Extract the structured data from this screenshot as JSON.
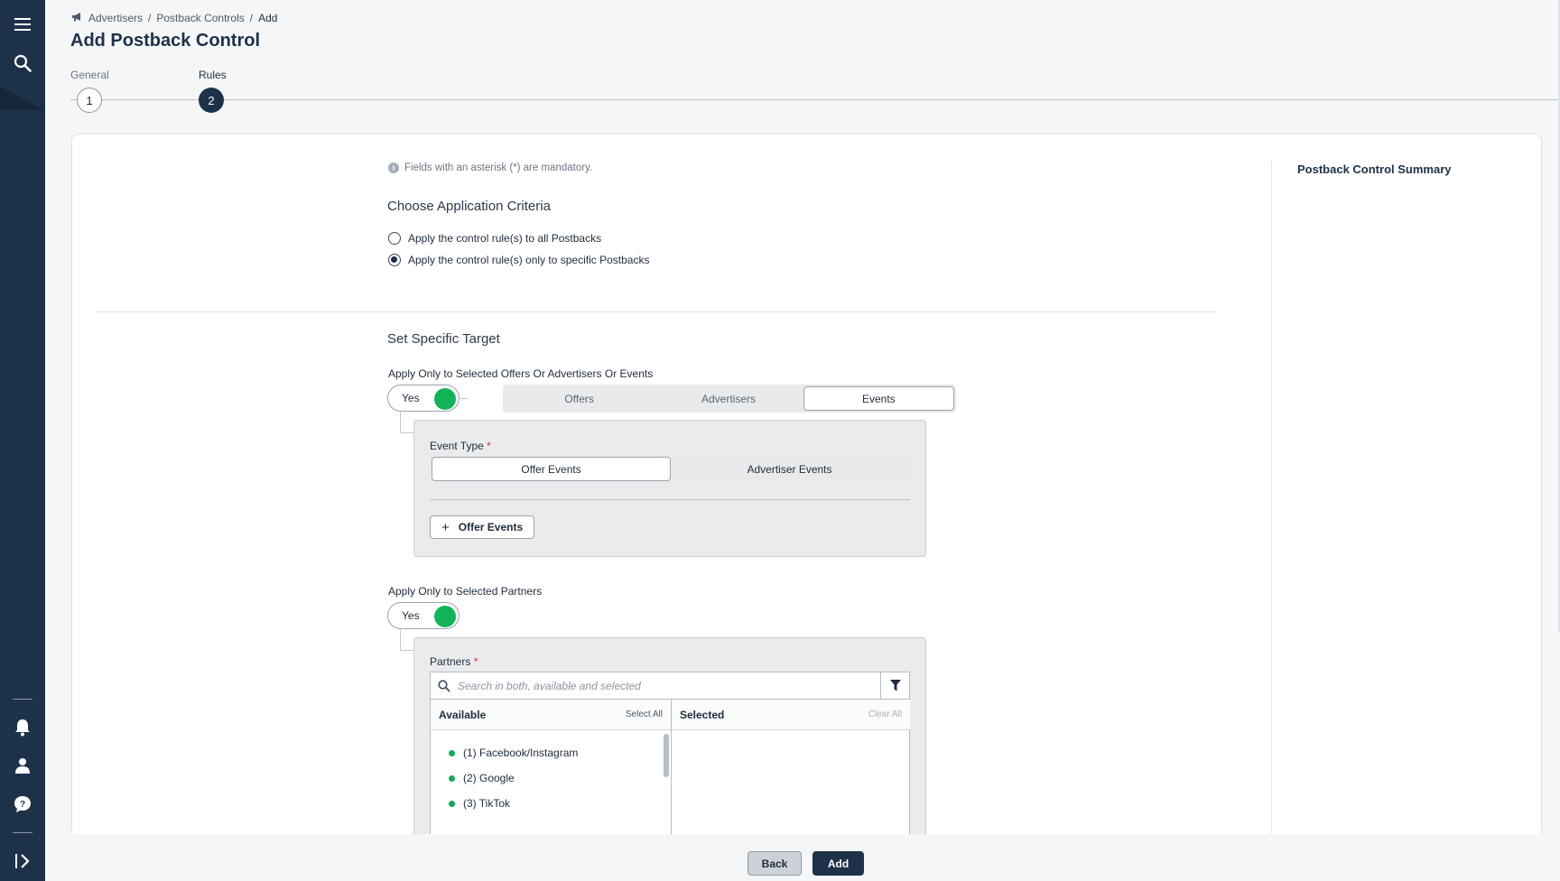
{
  "sidebar": {
    "icons": [
      "menu-icon",
      "search-icon",
      "bell-icon",
      "user-icon",
      "help-icon",
      "expand-icon"
    ]
  },
  "breadcrumb": {
    "items": [
      "Advertisers",
      "Postback Controls",
      "Add"
    ],
    "separator": "/"
  },
  "page": {
    "title": "Add Postback Control"
  },
  "steps": [
    {
      "label": "General",
      "number": "1",
      "state": "done"
    },
    {
      "label": "Rules",
      "number": "2",
      "state": "active"
    }
  ],
  "form": {
    "mandatory_note": "Fields with an asterisk (*) are mandatory.",
    "criteria_title": "Choose Application Criteria",
    "radio_options": [
      {
        "label": "Apply the control rule(s) to all Postbacks",
        "checked": false
      },
      {
        "label": "Apply the control rule(s) only to specific Postbacks",
        "checked": true
      }
    ],
    "target_title": "Set Specific Target",
    "offers_toggle": {
      "label": "Apply Only to Selected Offers Or Advertisers Or Events",
      "value": "Yes",
      "on": true
    },
    "target_tabs": [
      "Offers",
      "Advertisers",
      "Events"
    ],
    "target_tab_selected": "Events",
    "event_type": {
      "label": "Event Type",
      "required_mark": "*",
      "options": [
        "Offer Events",
        "Advertiser Events"
      ],
      "selected": "Offer Events",
      "add_button": "Offer Events",
      "add_symbol": "+"
    },
    "partners_toggle": {
      "label": "Apply Only to Selected Partners",
      "value": "Yes",
      "on": true
    },
    "partners": {
      "label": "Partners",
      "required_mark": "*",
      "search_placeholder": "Search in both, available and selected",
      "available_header": "Available",
      "select_all": "Select All",
      "selected_header": "Selected",
      "clear_all": "Clear All",
      "available_items": [
        "(1) Facebook/Instagram",
        "(2) Google",
        "(3) TikTok"
      ]
    }
  },
  "summary": {
    "title": "Postback Control Summary"
  },
  "footer": {
    "back_label": "Back",
    "add_label": "Add"
  },
  "colors": {
    "primary": "#1d3149",
    "toggle_on": "#13b35a",
    "status_dot": "#13a85a"
  }
}
